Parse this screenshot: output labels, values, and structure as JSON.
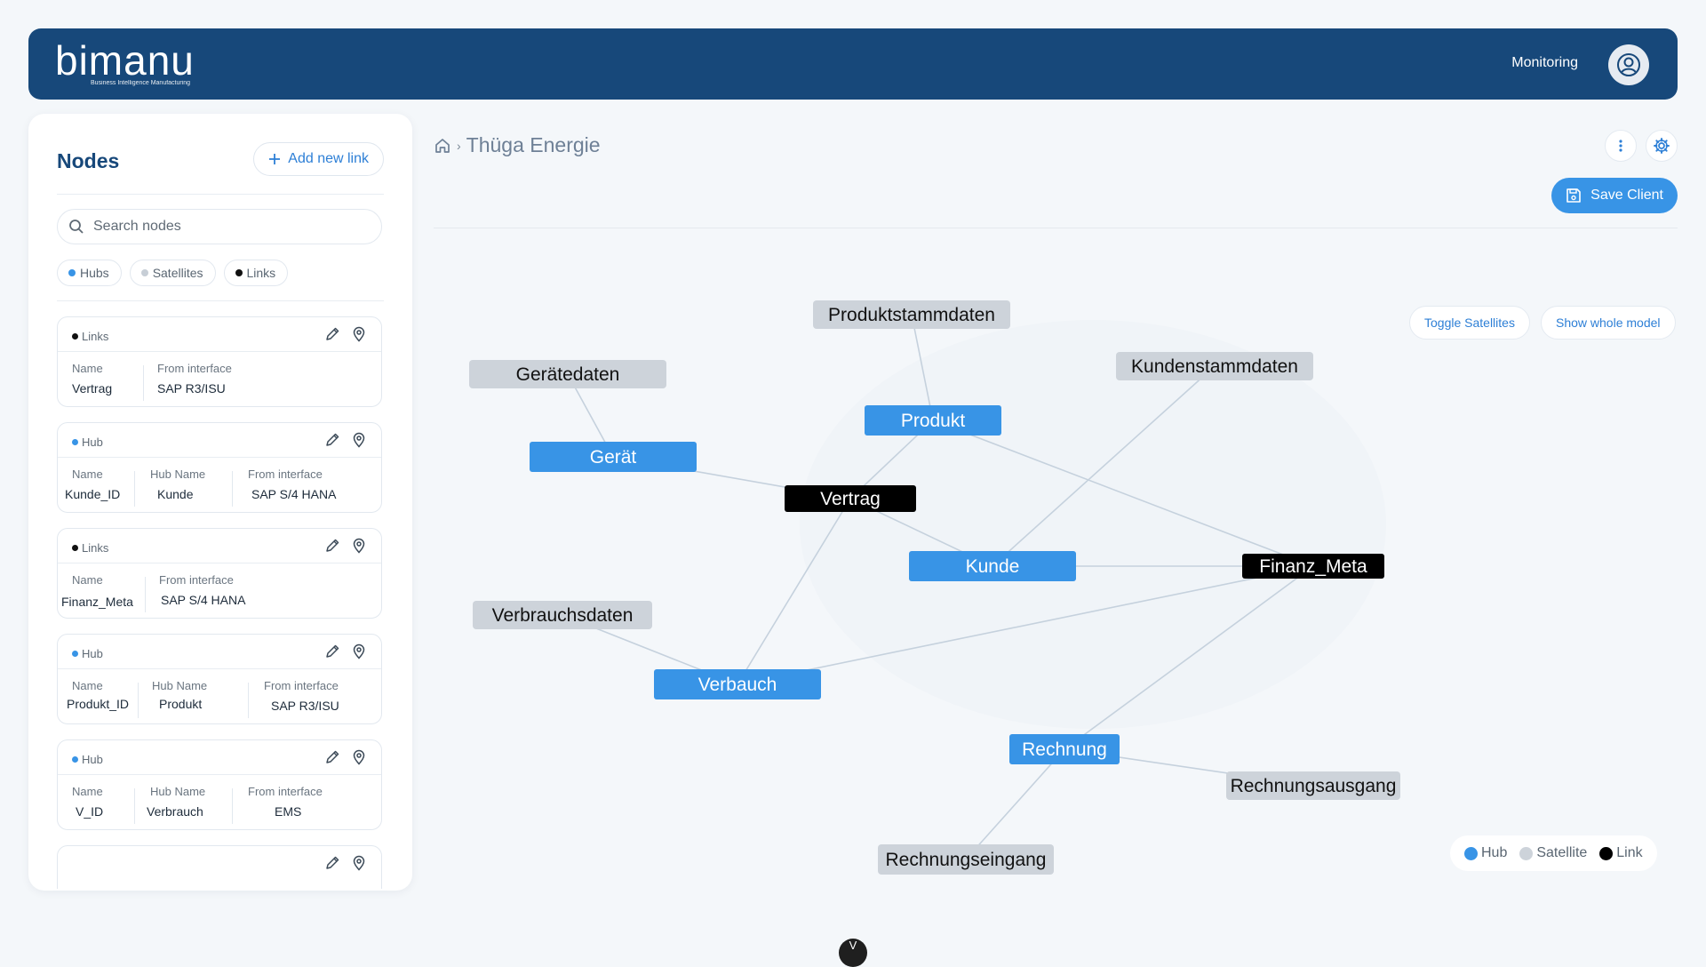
{
  "header": {
    "logo_main": "bimanu",
    "logo_sub": "Business Intelligence Manufacturing",
    "monitoring": "Monitoring"
  },
  "sidebar": {
    "title": "Nodes",
    "add_link": "Add new link",
    "search_placeholder": "Search nodes",
    "filters": [
      {
        "label": "Hubs",
        "color": "#3894e6"
      },
      {
        "label": "Satellites",
        "color": "#c7ced6"
      },
      {
        "label": "Links",
        "color": "#111111"
      }
    ],
    "cards": [
      {
        "type": "Links",
        "dot": "#111111",
        "fields": [
          {
            "label": "Name",
            "value": "Vertrag"
          },
          {
            "label": "From interface",
            "value": "SAP R3/ISU"
          }
        ]
      },
      {
        "type": "Hub",
        "dot": "#3894e6",
        "fields": [
          {
            "label": "Name",
            "value": "Kunde_ID"
          },
          {
            "label": "Hub Name",
            "value": "Kunde"
          },
          {
            "label": "From interface",
            "value": "SAP S/4 HANA"
          }
        ]
      },
      {
        "type": "Links",
        "dot": "#111111",
        "fields": [
          {
            "label": "Name",
            "value": "Finanz_Meta"
          },
          {
            "label": "From interface",
            "value": "SAP S/4 HANA"
          }
        ]
      },
      {
        "type": "Hub",
        "dot": "#3894e6",
        "fields": [
          {
            "label": "Name",
            "value": "Produkt_ID"
          },
          {
            "label": "Hub Name",
            "value": "Produkt"
          },
          {
            "label": "From interface",
            "value": "SAP R3/ISU"
          }
        ]
      },
      {
        "type": "Hub",
        "dot": "#3894e6",
        "fields": [
          {
            "label": "Name",
            "value": "V_ID"
          },
          {
            "label": "Hub Name",
            "value": "Verbrauch"
          },
          {
            "label": "From interface",
            "value": "EMS"
          }
        ]
      }
    ]
  },
  "main": {
    "breadcrumb_title": "Thüga Energie",
    "save_client": "Save Client",
    "toggle_satellites": "Toggle Satellites",
    "show_whole_model": "Show whole model"
  },
  "graph": {
    "colors": {
      "hub": "#3894e6",
      "satellite": "#cdd3da",
      "link": "#000000",
      "edge": "#c5d1dd"
    },
    "nodes": [
      {
        "id": "produktstammdaten",
        "label": "Produktstammdaten",
        "type": "satellite"
      },
      {
        "id": "geraetedaten",
        "label": "Gerätedaten",
        "type": "satellite"
      },
      {
        "id": "kundenstammdaten",
        "label": "Kundenstammdaten",
        "type": "satellite"
      },
      {
        "id": "produkt",
        "label": "Produkt",
        "type": "hub"
      },
      {
        "id": "geraet",
        "label": "Gerät",
        "type": "hub"
      },
      {
        "id": "vertrag",
        "label": "Vertrag",
        "type": "link"
      },
      {
        "id": "kunde",
        "label": "Kunde",
        "type": "hub"
      },
      {
        "id": "finanz_meta",
        "label": "Finanz_Meta",
        "type": "link"
      },
      {
        "id": "verbrauchsdaten",
        "label": "Verbrauchsdaten",
        "type": "satellite"
      },
      {
        "id": "verbauch",
        "label": "Verbauch",
        "type": "hub"
      },
      {
        "id": "rechnung",
        "label": "Rechnung",
        "type": "hub"
      },
      {
        "id": "rechnungsausgang",
        "label": "Rechnungsausgang",
        "type": "satellite"
      },
      {
        "id": "rechnungseingang",
        "label": "Rechnungseingang",
        "type": "satellite"
      }
    ],
    "edges": [
      [
        "produktstammdaten",
        "produkt"
      ],
      [
        "geraetedaten",
        "geraet"
      ],
      [
        "geraet",
        "vertrag"
      ],
      [
        "produkt",
        "vertrag"
      ],
      [
        "produkt",
        "finanz_meta"
      ],
      [
        "kundenstammdaten",
        "kunde"
      ],
      [
        "vertrag",
        "kunde"
      ],
      [
        "vertrag",
        "verbauch"
      ],
      [
        "kunde",
        "finanz_meta"
      ],
      [
        "verbrauchsdaten",
        "verbauch"
      ],
      [
        "verbauch",
        "finanz_meta"
      ],
      [
        "finanz_meta",
        "rechnung"
      ],
      [
        "rechnung",
        "rechnungsausgang"
      ],
      [
        "rechnung",
        "rechnungseingang"
      ]
    ]
  },
  "legend": [
    {
      "label": "Hub",
      "color": "#3894e6"
    },
    {
      "label": "Satellite",
      "color": "#cdd3da"
    },
    {
      "label": "Link",
      "color": "#000000"
    }
  ],
  "bottom_badge": "V"
}
